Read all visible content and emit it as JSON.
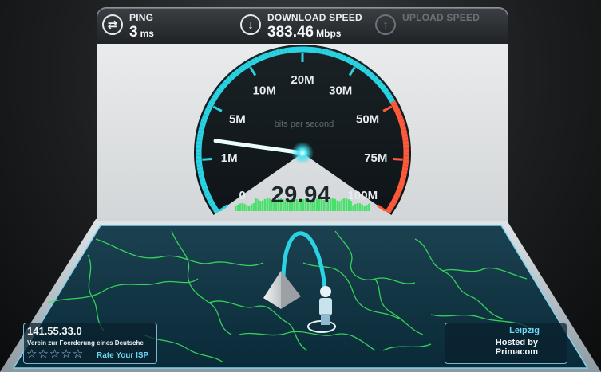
{
  "metrics": {
    "ping": {
      "label": "PING",
      "value": "3",
      "unit": "ms",
      "icon": "ping-arrows-icon"
    },
    "download": {
      "label": "DOWNLOAD SPEED",
      "value": "383.46",
      "unit": "Mbps",
      "icon": "download-arrow-icon"
    },
    "upload": {
      "label": "UPLOAD SPEED",
      "value": "",
      "unit": "",
      "icon": "upload-arrow-icon"
    }
  },
  "gauge": {
    "caption": "bits per second",
    "current_speed": "29.94",
    "needle_mbps": 2.5,
    "scale_labels": [
      "0",
      "1M",
      "5M",
      "10M",
      "20M",
      "30M",
      "50M",
      "75M",
      "100M"
    ],
    "colors": {
      "cyan": "#2ad3e3",
      "red": "#ff5a3a",
      "green": "#46e06a",
      "dark": "#1b2429"
    }
  },
  "isp": {
    "ip": "141.55.33.0",
    "name": "Verein zur Foerderung eines Deutsche",
    "rating_stars": 5,
    "rate_label": "Rate Your ISP"
  },
  "server": {
    "city": "Leipzig",
    "host_line1": "Hosted by",
    "host_line2": "Primacom"
  },
  "map": {
    "border_color": "#39e25b",
    "accent": "#2ad3e3"
  }
}
